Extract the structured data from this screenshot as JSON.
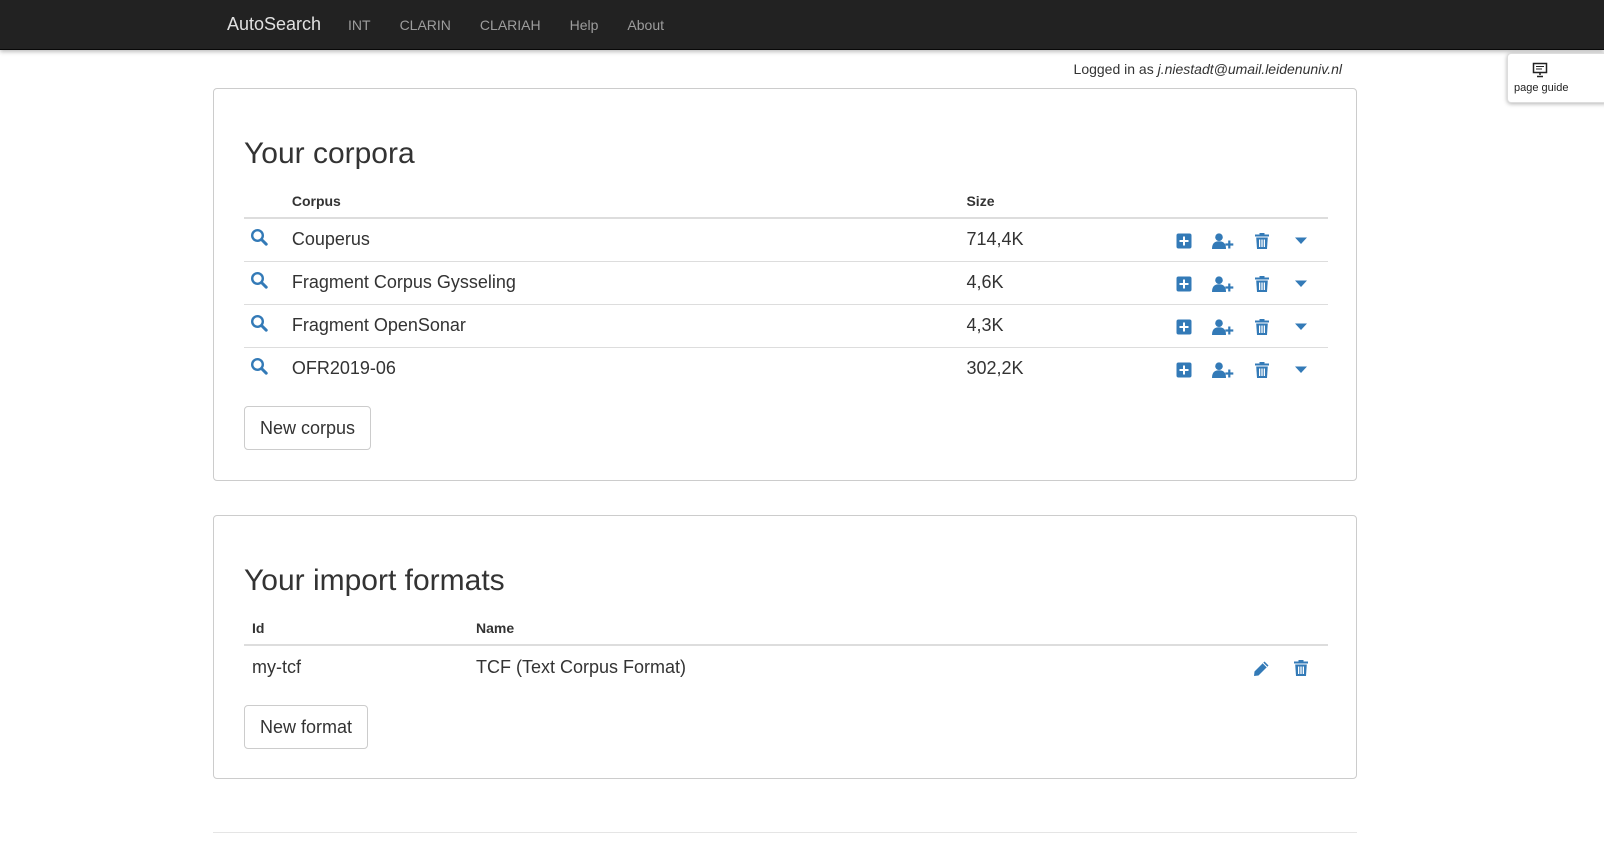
{
  "navbar": {
    "brand": "AutoSearch",
    "links": [
      "INT",
      "CLARIN",
      "CLARIAH",
      "Help",
      "About"
    ]
  },
  "login": {
    "prefix": "Logged in as",
    "user": "j.niestadt@umail.leidenuniv.nl"
  },
  "page_guide": {
    "label": "page guide",
    "icon": "presentation-icon"
  },
  "corpora": {
    "title": "Your corpora",
    "headers": {
      "corpus": "Corpus",
      "size": "Size"
    },
    "rows": [
      {
        "name": "Couperus",
        "size": "714,4K"
      },
      {
        "name": "Fragment Corpus Gysseling",
        "size": "4,6K"
      },
      {
        "name": "Fragment OpenSonar",
        "size": "4,3K"
      },
      {
        "name": "OFR2019-06",
        "size": "302,2K"
      }
    ],
    "row_icons": [
      "search-icon",
      "plus-square-icon",
      "user-plus-icon",
      "trash-icon",
      "caret-down-icon"
    ],
    "new_button": "New corpus"
  },
  "formats": {
    "title": "Your import formats",
    "headers": {
      "id": "Id",
      "name": "Name"
    },
    "rows": [
      {
        "id": "my-tcf",
        "name": "TCF (Text Corpus Format)"
      }
    ],
    "row_icons": [
      "pencil-icon",
      "trash-icon"
    ],
    "new_button": "New format"
  },
  "colors": {
    "navbar": "#222222",
    "accent": "#337ab7",
    "text": "#333333"
  }
}
